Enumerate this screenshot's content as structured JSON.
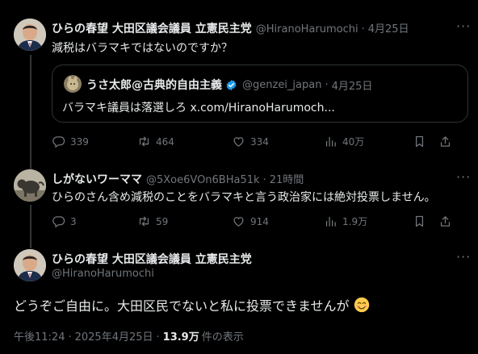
{
  "tweet1": {
    "name": "ひらの春望 大田区議会議員 立憲民主党",
    "handle": "@HiranoHarumochi",
    "sep": "·",
    "date": "4月25日",
    "text": "減税はバラマキではないのですか？",
    "quote": {
      "name": "うさ太郎@古典的自由主義",
      "handle": "@genzei_japan",
      "date": "4月25日",
      "text": "バラマキ議員は落選しろ x.com/HiranoHarumoch..."
    },
    "replies": "339",
    "retweets": "464",
    "likes": "334",
    "views": "40万"
  },
  "tweet2": {
    "name": "しがないワーママ",
    "handle": "@5Xoe6VOn6BHa51k",
    "sep": "·",
    "date": "21時間",
    "text": "ひらのさん含め減税のことをバラマキと言う政治家には絶対投票しません。",
    "replies": "3",
    "retweets": "59",
    "likes": "914",
    "views": "1.9万"
  },
  "tweet3": {
    "name": "ひらの春望 大田区議会議員 立憲民主党",
    "handle": "@HiranoHarumochi",
    "text": "どうぞご自由に。大田区民でないと私に投票できませんが",
    "emoji": "smiling-face-emoji",
    "time": "午後11:24",
    "sep": "·",
    "date": "2025年4月25日",
    "views": "13.9万",
    "views_suffix": "件の表示"
  },
  "icons": [
    "reply-icon",
    "retweet-icon",
    "like-icon",
    "views-icon",
    "bookmark-icon",
    "share-icon",
    "more-icon",
    "verified-icon"
  ],
  "colors": {
    "background": "#000000",
    "text": "#e7e9ea",
    "muted": "#71767b",
    "verified": "#1d9bf0",
    "border": "#2f3336"
  }
}
